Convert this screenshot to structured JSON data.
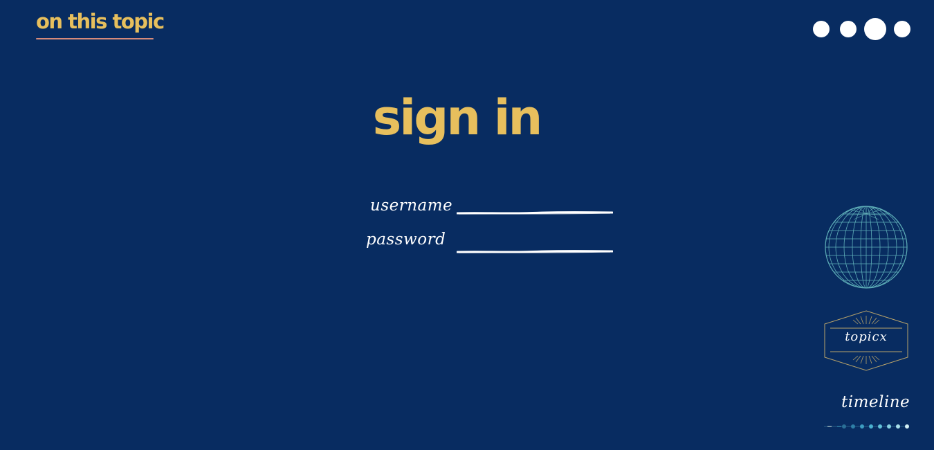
{
  "header": {
    "brand": "on this topic"
  },
  "nav_dots": {
    "count": 4,
    "active_index": 2
  },
  "main": {
    "title": "sign in",
    "username_label": "username",
    "password_label": "password",
    "username_value": "",
    "password_value": ""
  },
  "side": {
    "globe_icon": "globe-icon",
    "badge_label": "topicx",
    "timeline_label": "timeline"
  },
  "colors": {
    "background": "#082c61",
    "accent": "#e7bf5d",
    "text": "#ffffff",
    "underline": "#d58a7a",
    "globe": "#6ec6c8",
    "badge": "#b8a36a"
  }
}
